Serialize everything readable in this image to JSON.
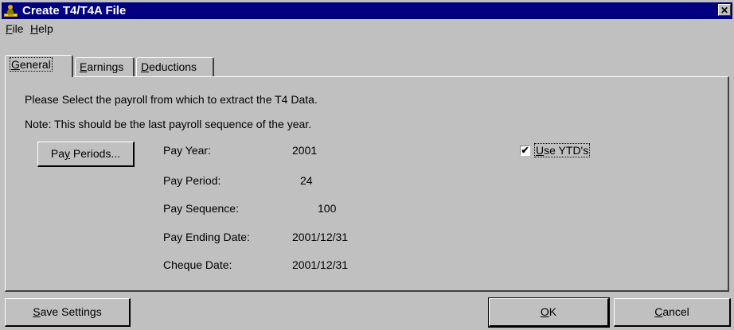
{
  "window": {
    "title": "Create T4/T4A File",
    "close_glyph": "✕"
  },
  "menu": {
    "file_first": "F",
    "file_rest": "ile",
    "help_first": "H",
    "help_rest": "elp"
  },
  "tabs": {
    "general": {
      "first": "G",
      "rest": "eneral"
    },
    "earnings": {
      "first": "E",
      "rest": "arnings"
    },
    "deductions": {
      "first": "D",
      "rest": "eductions"
    }
  },
  "general": {
    "instruction": "Please Select the payroll from which to extract the T4 Data.",
    "note": "Note: This should be the last payroll sequence of the year.",
    "pay_periods_pre": "Pa",
    "pay_periods_ul": "y",
    "pay_periods_post": " Periods...",
    "fields": {
      "pay_year_label": "Pay Year:",
      "pay_year_value": "2001",
      "pay_period_label": "Pay Period:",
      "pay_period_value": "24",
      "pay_sequence_label": "Pay Sequence:",
      "pay_sequence_value": "100",
      "pay_ending_date_label": "Pay Ending Date:",
      "pay_ending_date_value": "2001/12/31",
      "cheque_date_label": "Cheque Date:",
      "cheque_date_value": "2001/12/31"
    },
    "use_ytd_first": "U",
    "use_ytd_rest": "se YTD's",
    "use_ytd_checked": true,
    "check_glyph": "✔"
  },
  "buttons": {
    "save_first": "S",
    "save_rest": "ave Settings",
    "ok_first": "O",
    "ok_rest": "K",
    "cancel_first": "C",
    "cancel_rest": "ancel"
  },
  "icons": {
    "app": "person-coins-icon",
    "close": "close-icon",
    "checkbox": "checkmark-icon"
  }
}
